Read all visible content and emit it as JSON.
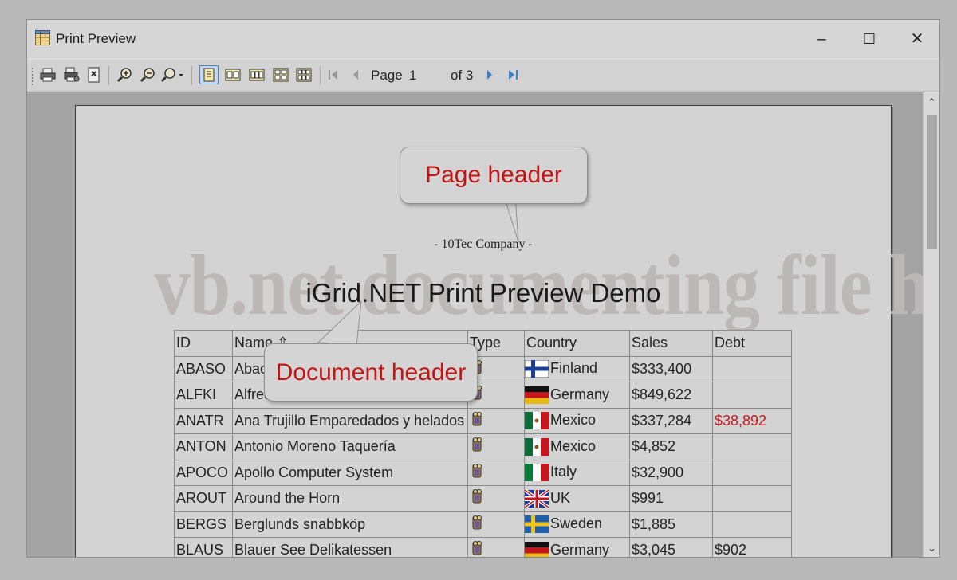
{
  "window": {
    "title": "Print Preview"
  },
  "window_controls": {
    "minimize": "–",
    "maximize": "☐",
    "close": "✕"
  },
  "toolbar": {
    "page_label": "Page",
    "page_number": "1",
    "of_pages": "of 3"
  },
  "preview": {
    "watermark": "vb.net documenting file header",
    "company": "- 10Tec Company -",
    "title": "iGrid.NET Print Preview Demo"
  },
  "callouts": {
    "page_header": "Page header",
    "document_header": "Document header"
  },
  "grid": {
    "columns": [
      "ID",
      "Name",
      "Type",
      "Country",
      "Sales",
      "Debt"
    ],
    "sort_indicator": "⇧",
    "rows": [
      {
        "id": "ABASO",
        "name": "Abaco Ordenadores",
        "country": "Finland",
        "flag": "finland",
        "sales": "$333,400",
        "debt": "",
        "debt_red": false
      },
      {
        "id": "ALFKI",
        "name": "Alfreds Futterkiste",
        "country": "Germany",
        "flag": "germany",
        "sales": "$849,622",
        "debt": "",
        "debt_red": false
      },
      {
        "id": "ANATR",
        "name": "Ana Trujillo Emparedados y helados",
        "country": "Mexico",
        "flag": "mexico",
        "sales": "$337,284",
        "debt": "$38,892",
        "debt_red": true
      },
      {
        "id": "ANTON",
        "name": "Antonio Moreno Taquería",
        "country": "Mexico",
        "flag": "mexico",
        "sales": "$4,852",
        "debt": "",
        "debt_red": false
      },
      {
        "id": "APOCO",
        "name": "Apollo Computer System",
        "country": "Italy",
        "flag": "italy",
        "sales": "$32,900",
        "debt": "",
        "debt_red": false
      },
      {
        "id": "AROUT",
        "name": "Around the Horn",
        "country": "UK",
        "flag": "uk",
        "sales": "$991",
        "debt": "",
        "debt_red": false
      },
      {
        "id": "BERGS",
        "name": "Berglunds snabbköp",
        "country": "Sweden",
        "flag": "sweden",
        "sales": "$1,885",
        "debt": "",
        "debt_red": false
      },
      {
        "id": "BLAUS",
        "name": "Blauer See Delikatessen",
        "country": "Germany",
        "flag": "germany",
        "sales": "$3,045",
        "debt": "$902",
        "debt_red": false
      }
    ]
  },
  "colors": {
    "callout_text": "#c01515",
    "debt_red": "#c8161e"
  }
}
